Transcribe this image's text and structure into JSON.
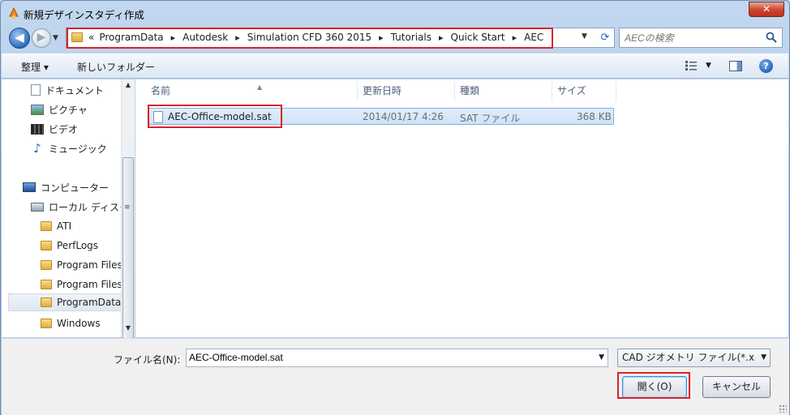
{
  "window": {
    "title": "新規デザインスタディ作成",
    "close_label": "✕"
  },
  "nav": {
    "back_label": "◀",
    "forward_label": "▶",
    "recent_label": "▼"
  },
  "address": {
    "prefix": "«",
    "crumbs": [
      "ProgramData",
      "Autodesk",
      "Simulation CFD 360 2015",
      "Tutorials",
      "Quick Start",
      "AEC"
    ],
    "dropdown_label": "▼",
    "refresh_label": "⟳"
  },
  "search": {
    "placeholder": "AECの検索"
  },
  "toolbar": {
    "organize_label": "整理 ▾",
    "new_folder_label": "新しいフォルダー",
    "view_arrow": "▼",
    "help_label": "?"
  },
  "sidebar": {
    "items": [
      {
        "label": "ドキュメント",
        "icon": "document-icon"
      },
      {
        "label": "ピクチャ",
        "icon": "picture-icon"
      },
      {
        "label": "ビデオ",
        "icon": "video-icon"
      },
      {
        "label": "ミュージック",
        "icon": "music-icon"
      },
      {
        "label": "コンピューター",
        "icon": "computer-icon"
      },
      {
        "label": "ローカル ディスク",
        "icon": "drive-icon"
      },
      {
        "label": "ATI",
        "icon": "folder-icon"
      },
      {
        "label": "PerfLogs",
        "icon": "folder-icon"
      },
      {
        "label": "Program Files",
        "icon": "folder-icon"
      },
      {
        "label": "Program Files",
        "icon": "folder-icon"
      },
      {
        "label": "ProgramData",
        "icon": "folder-icon",
        "selected": true
      },
      {
        "label": "Windows",
        "icon": "folder-icon"
      }
    ],
    "scroll_up": "▲",
    "scroll_down": "▼",
    "scroll_grip": "≡"
  },
  "filelist": {
    "columns": [
      "名前",
      "更新日時",
      "種類",
      "サイズ"
    ],
    "sort_indicator": "▲",
    "rows": [
      {
        "name": "AEC-Office-model.sat",
        "modified": "2014/01/17 4:26",
        "type": "SAT ファイル",
        "size": "368 KB"
      }
    ]
  },
  "bottom": {
    "filename_label": "ファイル名(N):",
    "filename_value": "AEC-Office-model.sat",
    "filename_drop": "▼",
    "filter_label": "CAD ジオメトリ ファイル(*.x",
    "filter_drop": "▼",
    "open_label": "開く(O)",
    "cancel_label": "キャンセル"
  },
  "colors": {
    "highlight": "#d9232a",
    "selection": "#cde2f8"
  }
}
